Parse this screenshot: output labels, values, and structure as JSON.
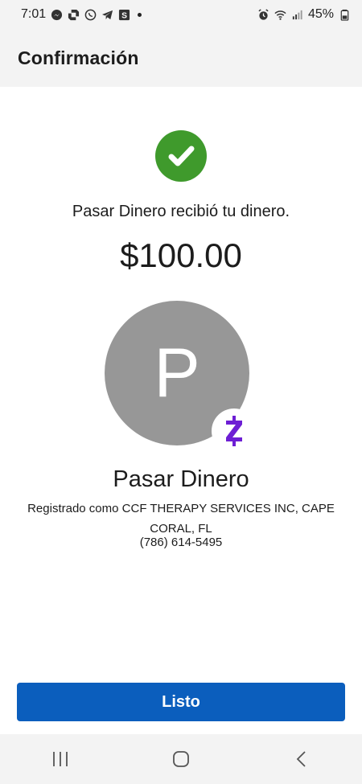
{
  "status_bar": {
    "time": "7:01",
    "battery": "45%",
    "left_icons": [
      "messenger-icon",
      "chase-icon",
      "whatsapp-icon",
      "telegram-icon",
      "s-app-icon",
      "dot-icon"
    ],
    "right_icons": [
      "alarm-icon",
      "wifi-icon",
      "signal-icon",
      "battery-icon"
    ],
    "s_app_letter": "S"
  },
  "header": {
    "title": "Confirmación"
  },
  "confirmation": {
    "message": "Pasar Dinero recibió tu dinero.",
    "amount": "$100.00",
    "success_color": "#3f9a2c"
  },
  "recipient": {
    "avatar_letter": "P",
    "name": "Pasar Dinero",
    "registered_as": "Registrado como CCF THERAPY SERVICES INC, CAPE CORAL, FL",
    "phone": "(786) 614-5495",
    "badge_icon": "zelle-icon",
    "badge_color": "#6d1ed4"
  },
  "actions": {
    "done_label": "Listo",
    "button_color": "#0b5ebd"
  },
  "nav": {
    "items": [
      "recent-apps-icon",
      "home-icon",
      "back-icon"
    ]
  }
}
